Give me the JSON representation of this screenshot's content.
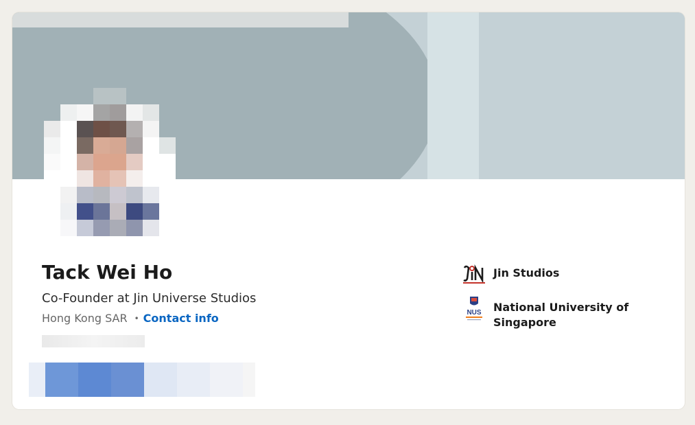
{
  "profile": {
    "name": "Tack Wei Ho",
    "headline": "Co-Founder at Jin Universe Studios",
    "location": "Hong Kong SAR",
    "separator": "•",
    "contact_link": "Contact info"
  },
  "affiliations": [
    {
      "name": "Jin Studios",
      "logo_icon": "jin-studios-logo"
    },
    {
      "name": "National University of Singapore",
      "logo_icon": "nus-logo"
    }
  ],
  "colors": {
    "link": "#0a66c2",
    "cover_dark": "#a1b1b6",
    "cover_light": "#c4d1d6"
  }
}
